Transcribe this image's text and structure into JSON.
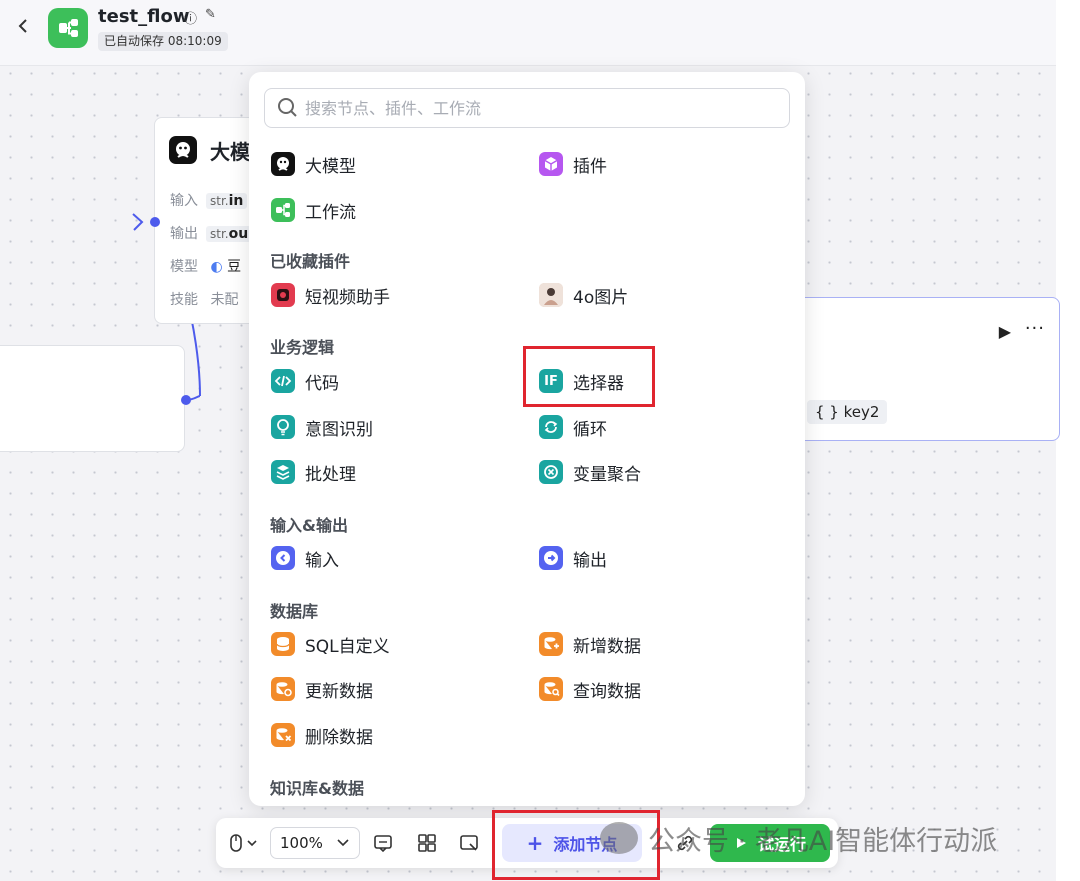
{
  "header": {
    "back_icon": "chevron-left-icon",
    "app_icon": "workflow-icon",
    "title": "test_flow",
    "info_icon": "ⓘ",
    "edit_icon": "✎",
    "save_status": "已自动保存 08:10:09"
  },
  "canvas": {
    "llm_node": {
      "title": "大模",
      "rows": [
        {
          "label": "输入",
          "tag": "str.",
          "value": "in"
        },
        {
          "label": "输出",
          "tag": "str.",
          "value": "ou"
        },
        {
          "label": "模型",
          "tag": "",
          "value": "豆"
        },
        {
          "label": "技能",
          "tag": "",
          "value": "未配"
        }
      ]
    },
    "right_node": {
      "run_icon": "▶",
      "more_icon": "···",
      "key_tag": "{ } key2"
    }
  },
  "popup": {
    "search_placeholder": "搜索节点、插件、工作流",
    "top_items": [
      {
        "label": "大模型",
        "icon": "llm-icon",
        "color": "#111111"
      },
      {
        "label": "插件",
        "icon": "plugin-icon",
        "color": "#b657f0"
      },
      {
        "label": "工作流",
        "icon": "workflow-icon",
        "color": "#3dbf5a"
      }
    ],
    "sections": [
      {
        "title": "已收藏插件",
        "items": [
          {
            "label": "短视频助手",
            "icon": "video-icon",
            "color": "#e23b4f"
          },
          {
            "label": "4o图片",
            "icon": "image-icon",
            "color": "#d9b6a3"
          }
        ]
      },
      {
        "title": "业务逻辑",
        "items": [
          {
            "label": "代码",
            "icon": "code-icon",
            "color": "#1aa5a0"
          },
          {
            "label": "选择器",
            "icon": "if-icon",
            "color": "#1aa5a0"
          },
          {
            "label": "意图识别",
            "icon": "intent-icon",
            "color": "#1aa5a0"
          },
          {
            "label": "循环",
            "icon": "loop-icon",
            "color": "#1aa5a0"
          },
          {
            "label": "批处理",
            "icon": "batch-icon",
            "color": "#1aa5a0"
          },
          {
            "label": "变量聚合",
            "icon": "aggregate-icon",
            "color": "#1aa5a0"
          }
        ]
      },
      {
        "title": "输入&输出",
        "items": [
          {
            "label": "输入",
            "icon": "input-icon",
            "color": "#5463f0"
          },
          {
            "label": "输出",
            "icon": "output-icon",
            "color": "#5463f0"
          }
        ]
      },
      {
        "title": "数据库",
        "items": [
          {
            "label": "SQL自定义",
            "icon": "database-icon",
            "color": "#f28b2a"
          },
          {
            "label": "新增数据",
            "icon": "database-add-icon",
            "color": "#f28b2a"
          },
          {
            "label": "更新数据",
            "icon": "database-update-icon",
            "color": "#f28b2a"
          },
          {
            "label": "查询数据",
            "icon": "database-query-icon",
            "color": "#f28b2a"
          },
          {
            "label": "删除数据",
            "icon": "database-delete-icon",
            "color": "#f28b2a"
          }
        ]
      },
      {
        "title": "知识库&数据",
        "items": []
      }
    ],
    "if_glyph": "IF"
  },
  "toolbar": {
    "mouse_icon": "mouse-icon",
    "zoom": "100%",
    "add_node": "添加节点",
    "test_run": "试运行"
  },
  "watermark": "公众号 · 老凡AI智能体行动派",
  "highlight_color": "#e0252f"
}
